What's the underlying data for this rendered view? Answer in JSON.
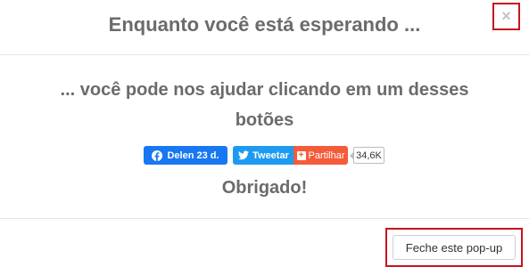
{
  "modal": {
    "title": "Enquanto você está esperando ...",
    "close_icon_glyph": "×",
    "message_line1": "... você pode nos ajudar clicando em um desses",
    "message_line2": "botões",
    "thanks": "Obrigado!",
    "close_button_label": "Feche este pop-up"
  },
  "social": {
    "facebook_label": "Delen 23 d.",
    "twitter_label": "Tweetar",
    "share_label": "Partilhar",
    "share_count": "34,6K",
    "icons": [
      "facebook-icon",
      "twitter-icon",
      "plus-icon"
    ]
  },
  "colors": {
    "facebook": "#1877f2",
    "twitter": "#1d9bf0",
    "share": "#f45b38",
    "highlight": "#c8141e",
    "text": "#6b6b6b"
  }
}
